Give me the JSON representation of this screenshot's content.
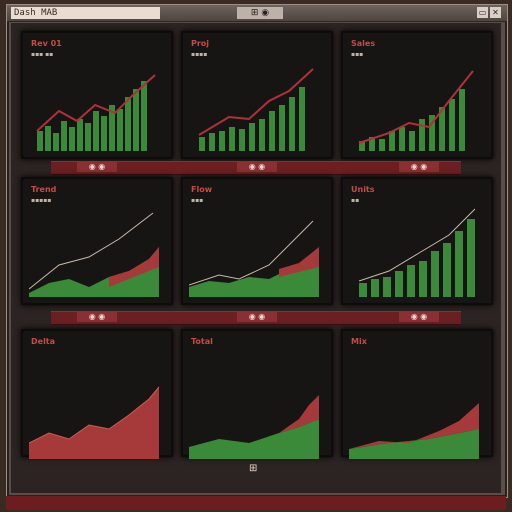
{
  "window": {
    "title": "Dash MAB",
    "center_label": "⊞ ◉",
    "buttons": [
      "▭",
      "✕"
    ]
  },
  "panels": [
    {
      "title": "Rev 01",
      "subtitle": "▪▪▪ ▪▪"
    },
    {
      "title": "Proj",
      "subtitle": "▪▪▪▪"
    },
    {
      "title": "Sales",
      "subtitle": "▪▪▪"
    },
    {
      "title": "Trend",
      "subtitle": "▪▪▪▪▪"
    },
    {
      "title": "Flow",
      "subtitle": "▪▪▪"
    },
    {
      "title": "Units",
      "subtitle": "▪▪"
    },
    {
      "title": "Delta",
      "subtitle": ""
    },
    {
      "title": "Total",
      "subtitle": ""
    },
    {
      "title": "Mix",
      "subtitle": ""
    }
  ],
  "row_labels": [
    "◉ ◉",
    "◉ ◉",
    "◉ ◉",
    "◉ ◉",
    "◉ ◉",
    "◉ ◉"
  ],
  "footer_label": "⊞",
  "colors": {
    "accent_red": "#c94a44",
    "accent_green": "#3a8a3a",
    "line": "#b0303a"
  }
}
